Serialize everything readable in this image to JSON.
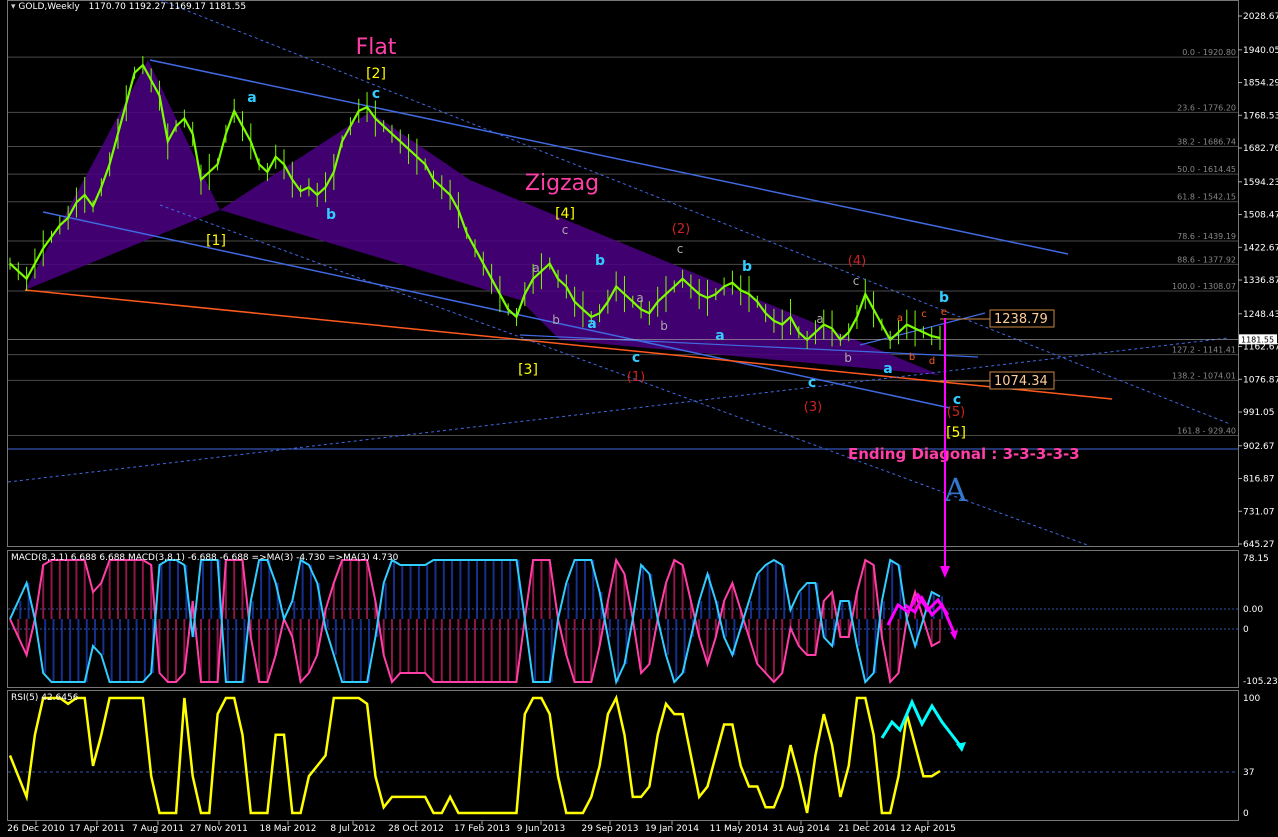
{
  "header": {
    "symbol": "GOLD,Weekly",
    "ohlc": "1170.70 1192.27 1169.17 1181.55"
  },
  "colors": {
    "background": "#000000",
    "price_line": "#7CFC00",
    "channel": "#4169E1",
    "triangle_fill": "#4B0082",
    "orange_line": "#FF5A1E",
    "macd_pink": "#FF3FA8",
    "macd_cyan": "#33CCFF",
    "rsi": "#FFFF00",
    "magenta": "#FF00FF",
    "annotation_cyan": "#00FFFF"
  },
  "price_axis": {
    "ticks": [
      "2028.67",
      "1940.05",
      "1854.29",
      "1768.53",
      "1682.76",
      "1594.23",
      "1508.47",
      "1422.67",
      "1336.87",
      "1248.43",
      "1162.67",
      "1076.87",
      "991.05",
      "902.67",
      "816.87",
      "731.07",
      "645.27"
    ],
    "last_price": "1181.55"
  },
  "fib_levels": [
    {
      "label": "0.0 - 1920.80"
    },
    {
      "label": "23.6 - 1776.20"
    },
    {
      "label": "38.2 - 1686.74"
    },
    {
      "label": "50.0 - 1614.45"
    },
    {
      "label": "61.8 - 1542.15"
    },
    {
      "label": "78.6 - 1439.19"
    },
    {
      "label": "88.6 - 1377.92"
    },
    {
      "label": "100.0 - 1308.07"
    },
    {
      "label": "127.2 - 1141.41"
    },
    {
      "label": "138.2 - 1074.01"
    },
    {
      "label": "161.8 - 929.40"
    }
  ],
  "price_boxes": {
    "upper": "1238.79",
    "lower": "1074.34"
  },
  "annotations": {
    "flat": "Flat",
    "zigzag": "Zigzag",
    "ending_diagonal": "Ending Diagonal : 3-3-3-3-3",
    "big_a": "A",
    "wave_1": "[1]",
    "wave_2": "[2]",
    "wave_3": "[3]",
    "wave_4": "[4]",
    "wave_5": "[5]",
    "sub_1": "(1)",
    "sub_2": "(2)",
    "sub_3": "(3)",
    "sub_4": "(4)",
    "sub_5": "(5)",
    "a": "a",
    "b": "b",
    "c": "c",
    "d": "d",
    "e": "e"
  },
  "macd": {
    "label": "MACD(8,3,1) 6.688 6.688  MACD(3,8,1) -6.688 -6.688  =>MA(3) -4.730  =>MA(3) 4.730",
    "ticks": [
      "78.15",
      "0.00",
      "0",
      "-105.234"
    ]
  },
  "rsi": {
    "label": "RSI(5) 42.6456",
    "ticks": [
      "100",
      "37",
      "0"
    ]
  },
  "time_axis": [
    "26 Dec 2010",
    "17 Apr 2011",
    "7 Aug 2011",
    "27 Nov 2011",
    "18 Mar 2012",
    "8 Jul 2012",
    "28 Oct 2012",
    "17 Feb 2013",
    "9 Jun 2013",
    "29 Sep 2013",
    "19 Jan 2014",
    "11 May 2014",
    "31 Aug 2014",
    "21 Dec 2014",
    "12 Apr 2015"
  ],
  "chart_data": {
    "type": "line",
    "title": "GOLD,Weekly",
    "symbol": "GOLD",
    "timeframe": "Weekly",
    "x_labels": [
      "26 Dec 2010",
      "17 Apr 2011",
      "7 Aug 2011",
      "27 Nov 2011",
      "18 Mar 2012",
      "8 Jul 2012",
      "28 Oct 2012",
      "17 Feb 2013",
      "9 Jun 2013",
      "29 Sep 2013",
      "19 Jan 2014",
      "11 May 2014",
      "31 Aug 2014",
      "21 Dec 2014",
      "12 Apr 2015"
    ],
    "ylim": [
      645.27,
      2028.67
    ],
    "series": [
      {
        "values": [
          1380,
          1360,
          1340,
          1380,
          1420,
          1450,
          1480,
          1500,
          1540,
          1560,
          1530,
          1580,
          1640,
          1720,
          1800,
          1880,
          1900,
          1860,
          1820,
          1700,
          1740,
          1760,
          1720,
          1600,
          1620,
          1640,
          1720,
          1780,
          1740,
          1700,
          1640,
          1620,
          1660,
          1640,
          1600,
          1570,
          1580,
          1560,
          1580,
          1620,
          1700,
          1740,
          1780,
          1790,
          1760,
          1740,
          1720,
          1700,
          1680,
          1660,
          1640,
          1600,
          1580,
          1560,
          1520,
          1460,
          1420,
          1380,
          1340,
          1300,
          1260,
          1240,
          1300,
          1340,
          1360,
          1380,
          1340,
          1320,
          1280,
          1260,
          1240,
          1250,
          1280,
          1320,
          1300,
          1280,
          1260,
          1250,
          1280,
          1300,
          1320,
          1340,
          1320,
          1300,
          1290,
          1300,
          1320,
          1330,
          1310,
          1300,
          1280,
          1250,
          1230,
          1220,
          1240,
          1200,
          1180,
          1200,
          1220,
          1210,
          1180,
          1200,
          1240,
          1300,
          1260,
          1220,
          1180,
          1200,
          1220,
          1210,
          1200,
          1190,
          1185
        ]
      }
    ]
  }
}
